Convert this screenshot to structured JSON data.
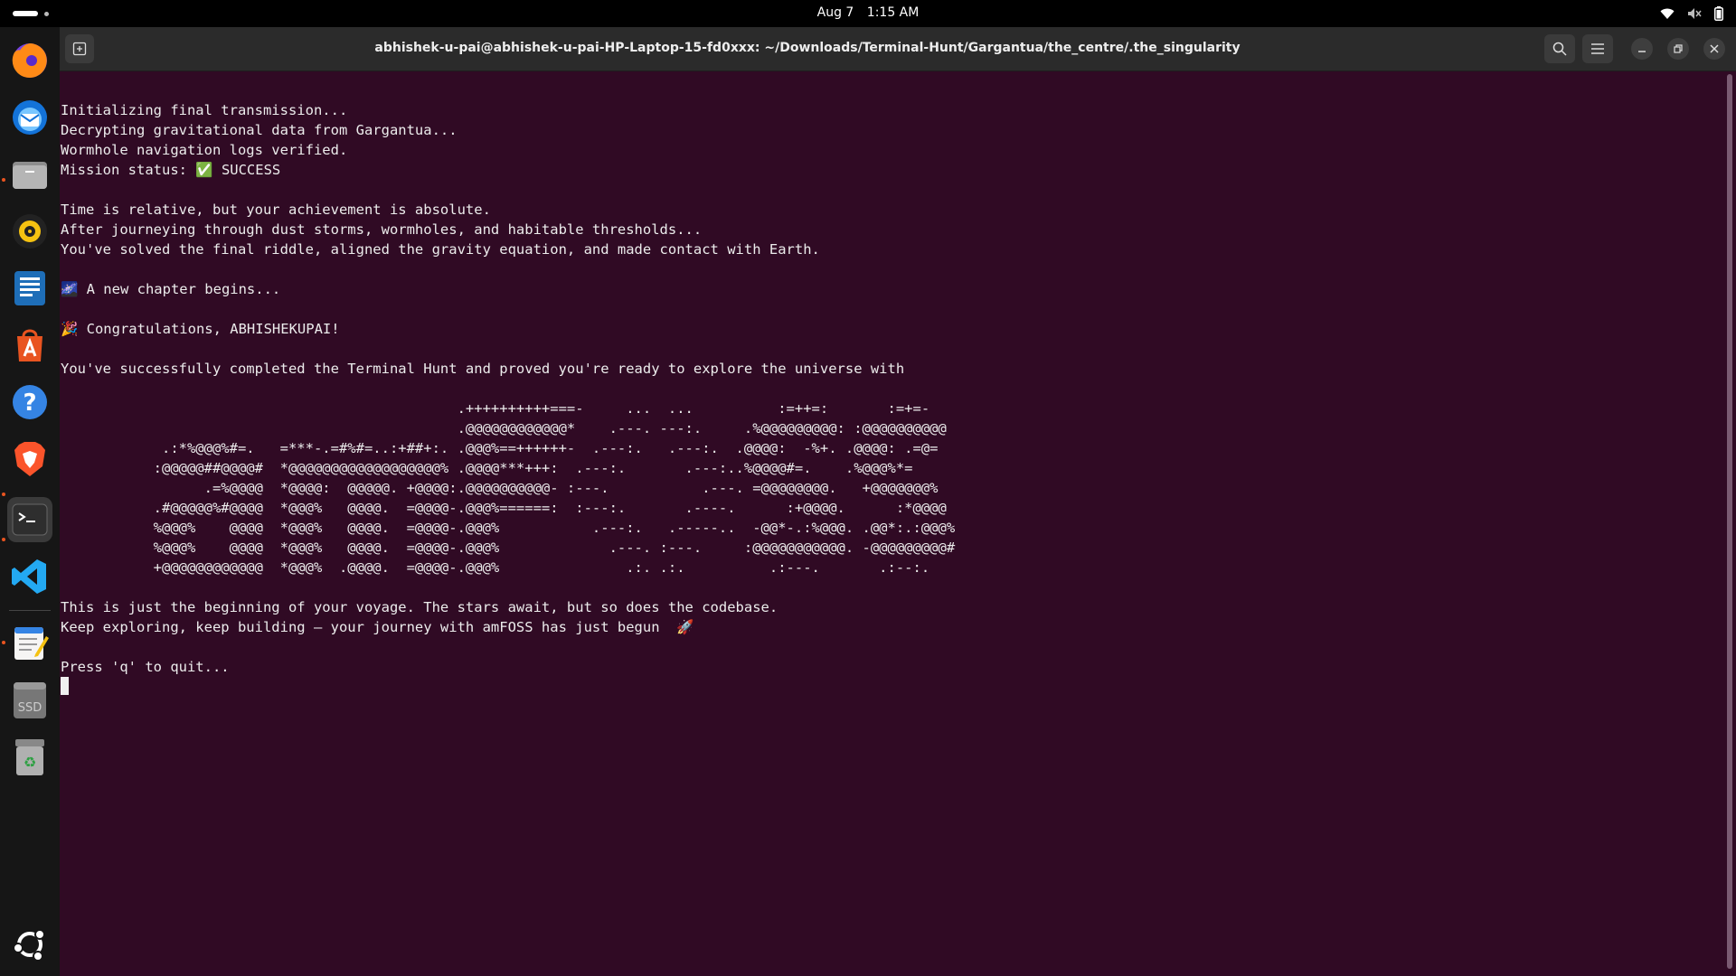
{
  "topbar": {
    "date": "Aug 7",
    "time": "1:15 AM"
  },
  "dock": {
    "apps": [
      {
        "name": "Firefox",
        "icon": "firefox-icon"
      },
      {
        "name": "Thunderbird",
        "icon": "thunderbird-icon"
      },
      {
        "name": "Files",
        "icon": "files-icon"
      },
      {
        "name": "Rhythmbox",
        "icon": "rhythmbox-icon"
      },
      {
        "name": "LibreOffice Writer",
        "icon": "writer-icon"
      },
      {
        "name": "App Center",
        "icon": "app-center-icon"
      },
      {
        "name": "Help",
        "icon": "help-icon"
      },
      {
        "name": "Brave",
        "icon": "brave-icon"
      },
      {
        "name": "Terminal",
        "icon": "terminal-icon"
      },
      {
        "name": "Visual Studio Code",
        "icon": "vscode-icon"
      },
      {
        "name": "Text Editor",
        "icon": "text-editor-icon"
      },
      {
        "name": "SSD",
        "icon": "ssd-drive-icon"
      },
      {
        "name": "Trash",
        "icon": "trash-icon"
      },
      {
        "name": "Show Apps",
        "icon": "show-apps-icon"
      }
    ],
    "ssd_label": "SSD"
  },
  "window": {
    "title": "abhishek-u-pai@abhishek-u-pai-HP-Laptop-15-fd0xxx: ~/Downloads/Terminal-Hunt/Gargantua/the_centre/.the_singularity"
  },
  "terminal": {
    "lines": [
      "Initializing final transmission...",
      "Decrypting gravitational data from Gargantua...",
      "Wormhole navigation logs verified.",
      "Mission status: ✅ SUCCESS",
      "",
      "Time is relative, but your achievement is absolute.",
      "After journeying through dust storms, wormholes, and habitable thresholds...",
      "You've solved the final riddle, aligned the gravity equation, and made contact with Earth.",
      "",
      "🌌 A new chapter begins...",
      "",
      "🎉 Congratulations, ABHISHEKUPAI!",
      "",
      "You've successfully completed the Terminal Hunt and proved you're ready to explore the universe with",
      "",
      "                                               .++++++++++===-     ...  ...          :=++=:       :=+=-",
      "                                               .@@@@@@@@@@@@*    .---. ---:.     .%@@@@@@@@@: :@@@@@@@@@@",
      "            .:*%@@@%#=.   =***-.=#%#=..:+##+:. .@@@%==++++++-  .---:.   .---:.  .@@@@:  -%+. .@@@@: .=@=",
      "           :@@@@@##@@@@#  *@@@@@@@@@@@@@@@@@@% .@@@@***+++:  .---:.       .---:..%@@@@#=.    .%@@@%*=",
      "                 .=%@@@@  *@@@@:  @@@@@. +@@@@:.@@@@@@@@@@- :---.           .---. =@@@@@@@@.   +@@@@@@@%",
      "           .#@@@@@%#@@@@  *@@@%   @@@@.  =@@@@-.@@@%======:  :---:.       .----.      :+@@@@.      :*@@@@",
      "           %@@@%    @@@@  *@@@%   @@@@.  =@@@@-.@@@%           .---:.   .-----..  -@@*-.:%@@@. .@@*:.:@@@%",
      "           %@@@%    @@@@  *@@@%   @@@@.  =@@@@-.@@@%             .---. :---.     :@@@@@@@@@@@. -@@@@@@@@@#",
      "           +@@@@@@@@@@@@  *@@@%  .@@@@.  =@@@@-.@@@%               .:. .:.          .:---.       .:--:.",
      "",
      "This is just the beginning of your voyage. The stars await, but so does the codebase.",
      "Keep exploring, keep building — your journey with amFOSS has just begun  🚀",
      "",
      "Press 'q' to quit..."
    ]
  },
  "colors": {
    "terminal_bg": "#300a24",
    "terminal_fg": "#ececec",
    "ubuntu_orange": "#e95420"
  }
}
